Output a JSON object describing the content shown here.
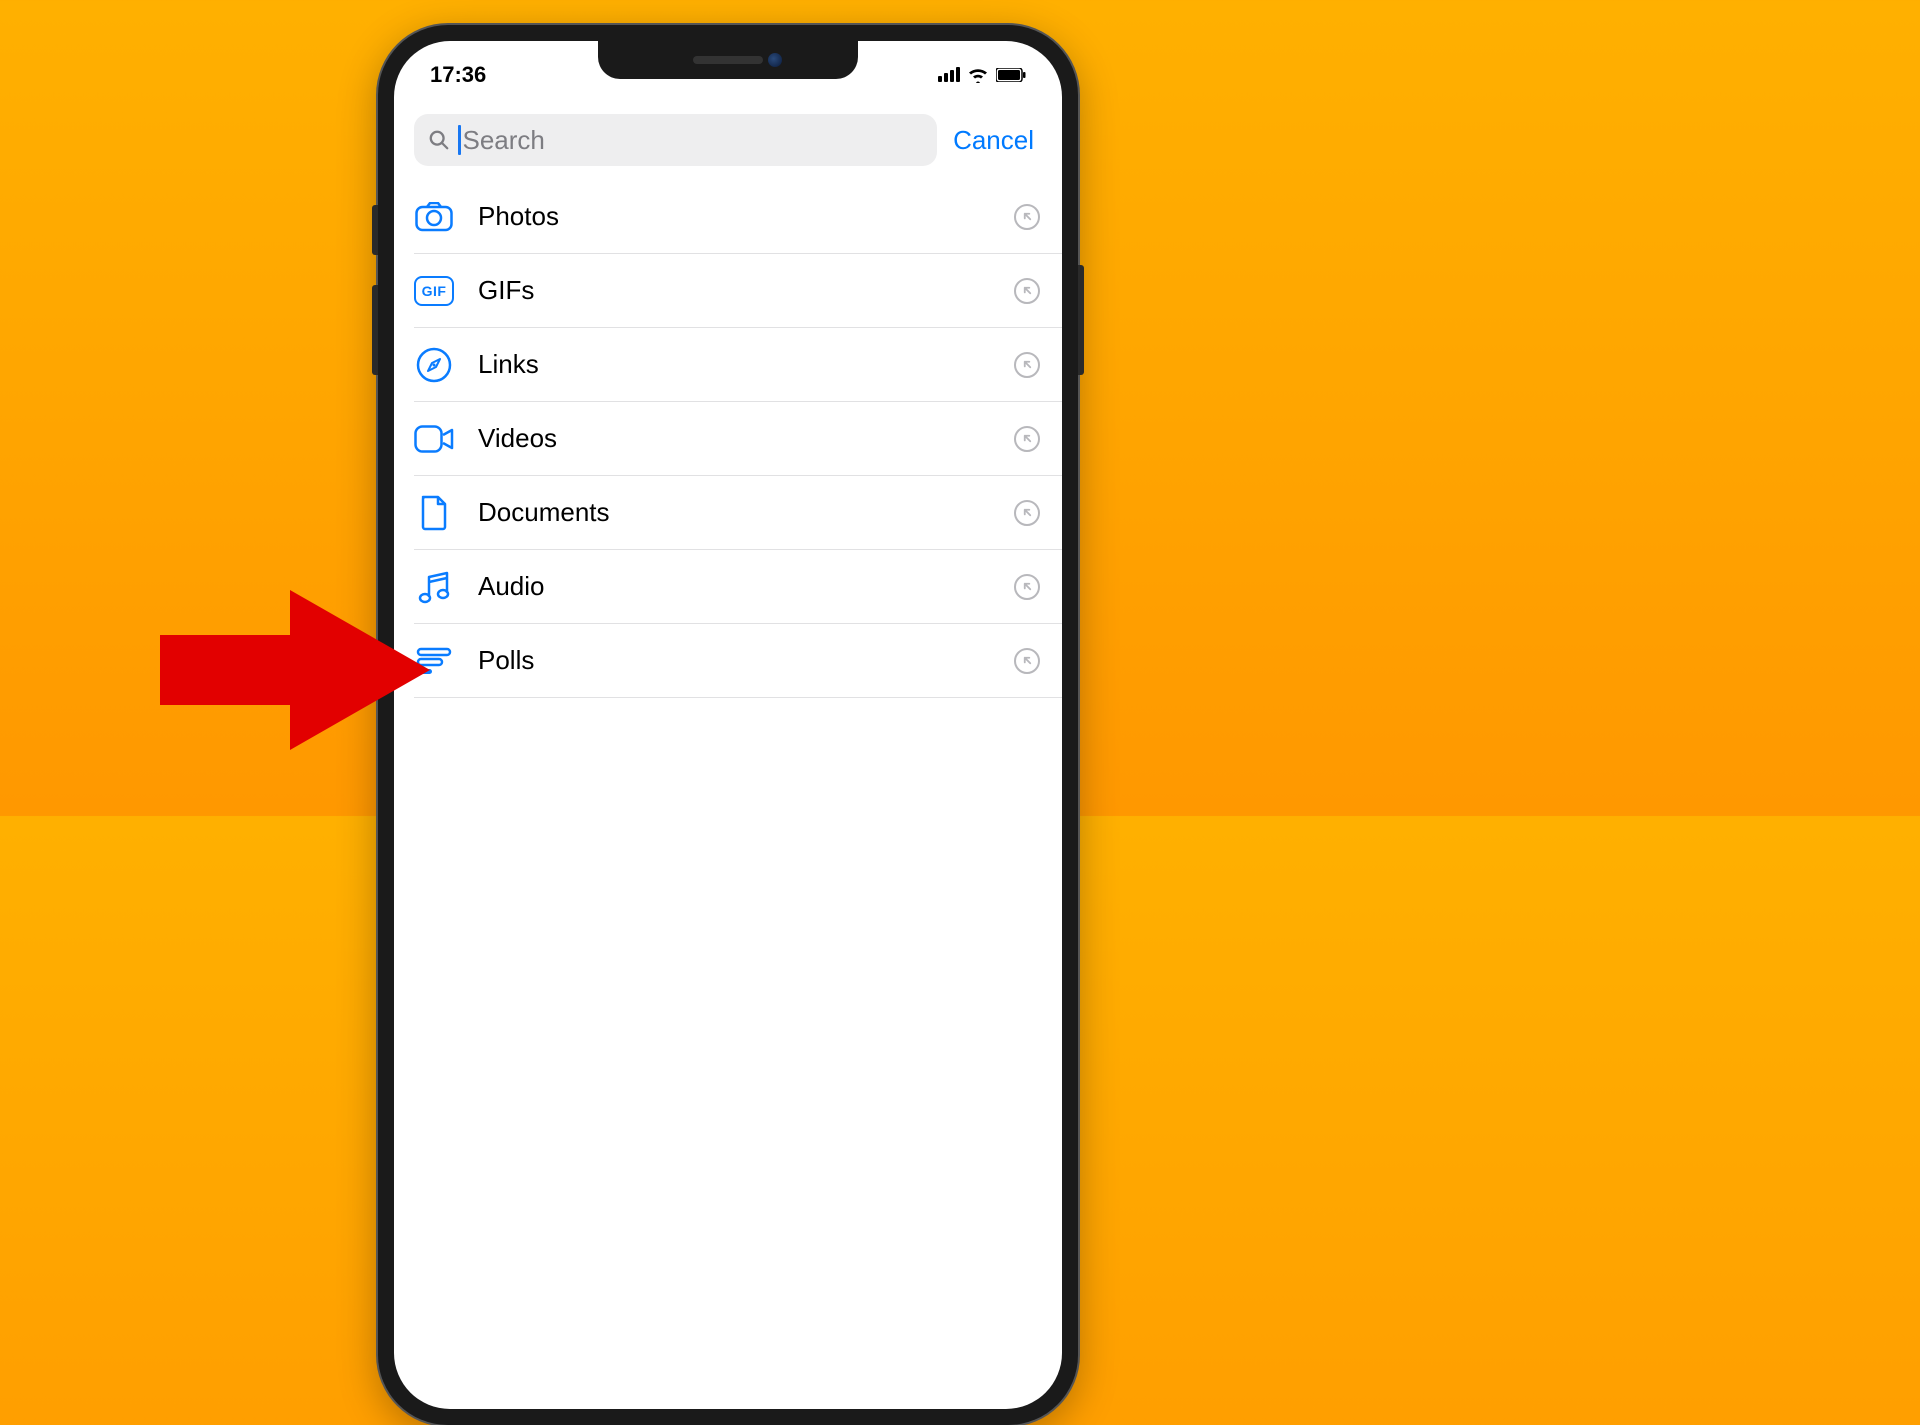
{
  "status": {
    "time": "17:36"
  },
  "search": {
    "placeholder": "Search",
    "cancel": "Cancel"
  },
  "categories": [
    {
      "id": "photos",
      "label": "Photos",
      "icon": "camera-icon"
    },
    {
      "id": "gifs",
      "label": "GIFs",
      "icon": "gif-icon",
      "gif_text": "GIF"
    },
    {
      "id": "links",
      "label": "Links",
      "icon": "compass-icon"
    },
    {
      "id": "videos",
      "label": "Videos",
      "icon": "video-icon"
    },
    {
      "id": "documents",
      "label": "Documents",
      "icon": "document-icon"
    },
    {
      "id": "audio",
      "label": "Audio",
      "icon": "music-icon"
    },
    {
      "id": "polls",
      "label": "Polls",
      "icon": "poll-icon"
    }
  ],
  "colors": {
    "accent": "#0a7cff",
    "ios_blue": "#007aff",
    "arrow": "#e20000"
  },
  "annotation": {
    "type": "arrow",
    "points_to": "polls"
  }
}
